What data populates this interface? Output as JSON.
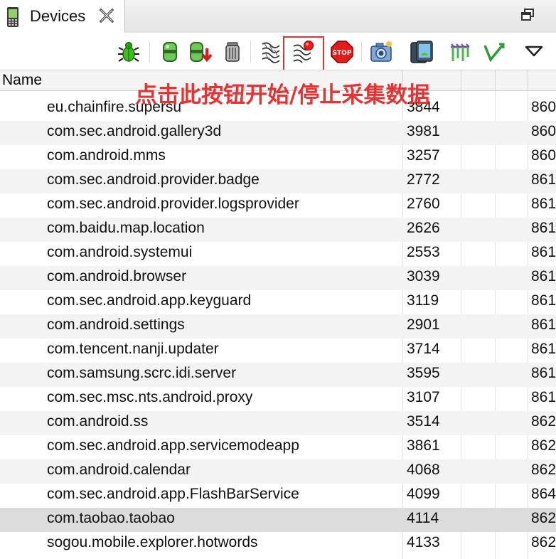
{
  "tab": {
    "title": "Devices"
  },
  "header": {
    "name": "Name"
  },
  "annotation": "点击此按钮开始/停止采集数据",
  "toolbar": {
    "buttons": [
      {
        "id": "debug",
        "icon": "debug-bug-icon"
      },
      {
        "id": "update-heap",
        "icon": "update-heap-icon"
      },
      {
        "id": "dump-hprof",
        "icon": "dump-hprof-icon"
      },
      {
        "id": "cause-gc",
        "icon": "gc-trash-icon"
      },
      {
        "id": "update-threads",
        "icon": "update-threads-icon"
      },
      {
        "id": "method-profiling",
        "icon": "method-profiling-icon"
      },
      {
        "id": "stop-process",
        "icon": "stop-icon"
      },
      {
        "id": "screen-capture",
        "icon": "camera-icon"
      },
      {
        "id": "dump-view-hierarchy",
        "icon": "device-ui-dump-icon"
      },
      {
        "id": "systrace",
        "icon": "systrace-icon"
      },
      {
        "id": "opengl-trace",
        "icon": "opengl-trace-icon"
      },
      {
        "id": "view-menu",
        "icon": "chevron-down-icon"
      }
    ]
  },
  "rows": [
    {
      "name": "eu.chainfire.supersu",
      "pid": "3844",
      "port": "860"
    },
    {
      "name": "com.sec.android.gallery3d",
      "pid": "3981",
      "port": "860"
    },
    {
      "name": "com.android.mms",
      "pid": "3257",
      "port": "860"
    },
    {
      "name": "com.sec.android.provider.badge",
      "pid": "2772",
      "port": "861"
    },
    {
      "name": "com.sec.android.provider.logsprovider",
      "pid": "2760",
      "port": "861"
    },
    {
      "name": "com.baidu.map.location",
      "pid": "2626",
      "port": "861"
    },
    {
      "name": "com.android.systemui",
      "pid": "2553",
      "port": "861"
    },
    {
      "name": "com.android.browser",
      "pid": "3039",
      "port": "861"
    },
    {
      "name": "com.sec.android.app.keyguard",
      "pid": "3119",
      "port": "861"
    },
    {
      "name": "com.android.settings",
      "pid": "2901",
      "port": "861"
    },
    {
      "name": "com.tencent.nanji.updater",
      "pid": "3714",
      "port": "861"
    },
    {
      "name": "com.samsung.scrc.idi.server",
      "pid": "3595",
      "port": "861"
    },
    {
      "name": "com.sec.msc.nts.android.proxy",
      "pid": "3107",
      "port": "861"
    },
    {
      "name": "com.android.ss",
      "pid": "3514",
      "port": "862"
    },
    {
      "name": "com.sec.android.app.servicemodeapp",
      "pid": "3861",
      "port": "862"
    },
    {
      "name": "com.android.calendar",
      "pid": "4068",
      "port": "862"
    },
    {
      "name": "com.sec.android.app.FlashBarService",
      "pid": "4099",
      "port": "864"
    },
    {
      "name": "com.taobao.taobao",
      "pid": "4114",
      "port": "862",
      "selected": true
    },
    {
      "name": "sogou.mobile.explorer.hotwords",
      "pid": "4133",
      "port": "862"
    }
  ]
}
